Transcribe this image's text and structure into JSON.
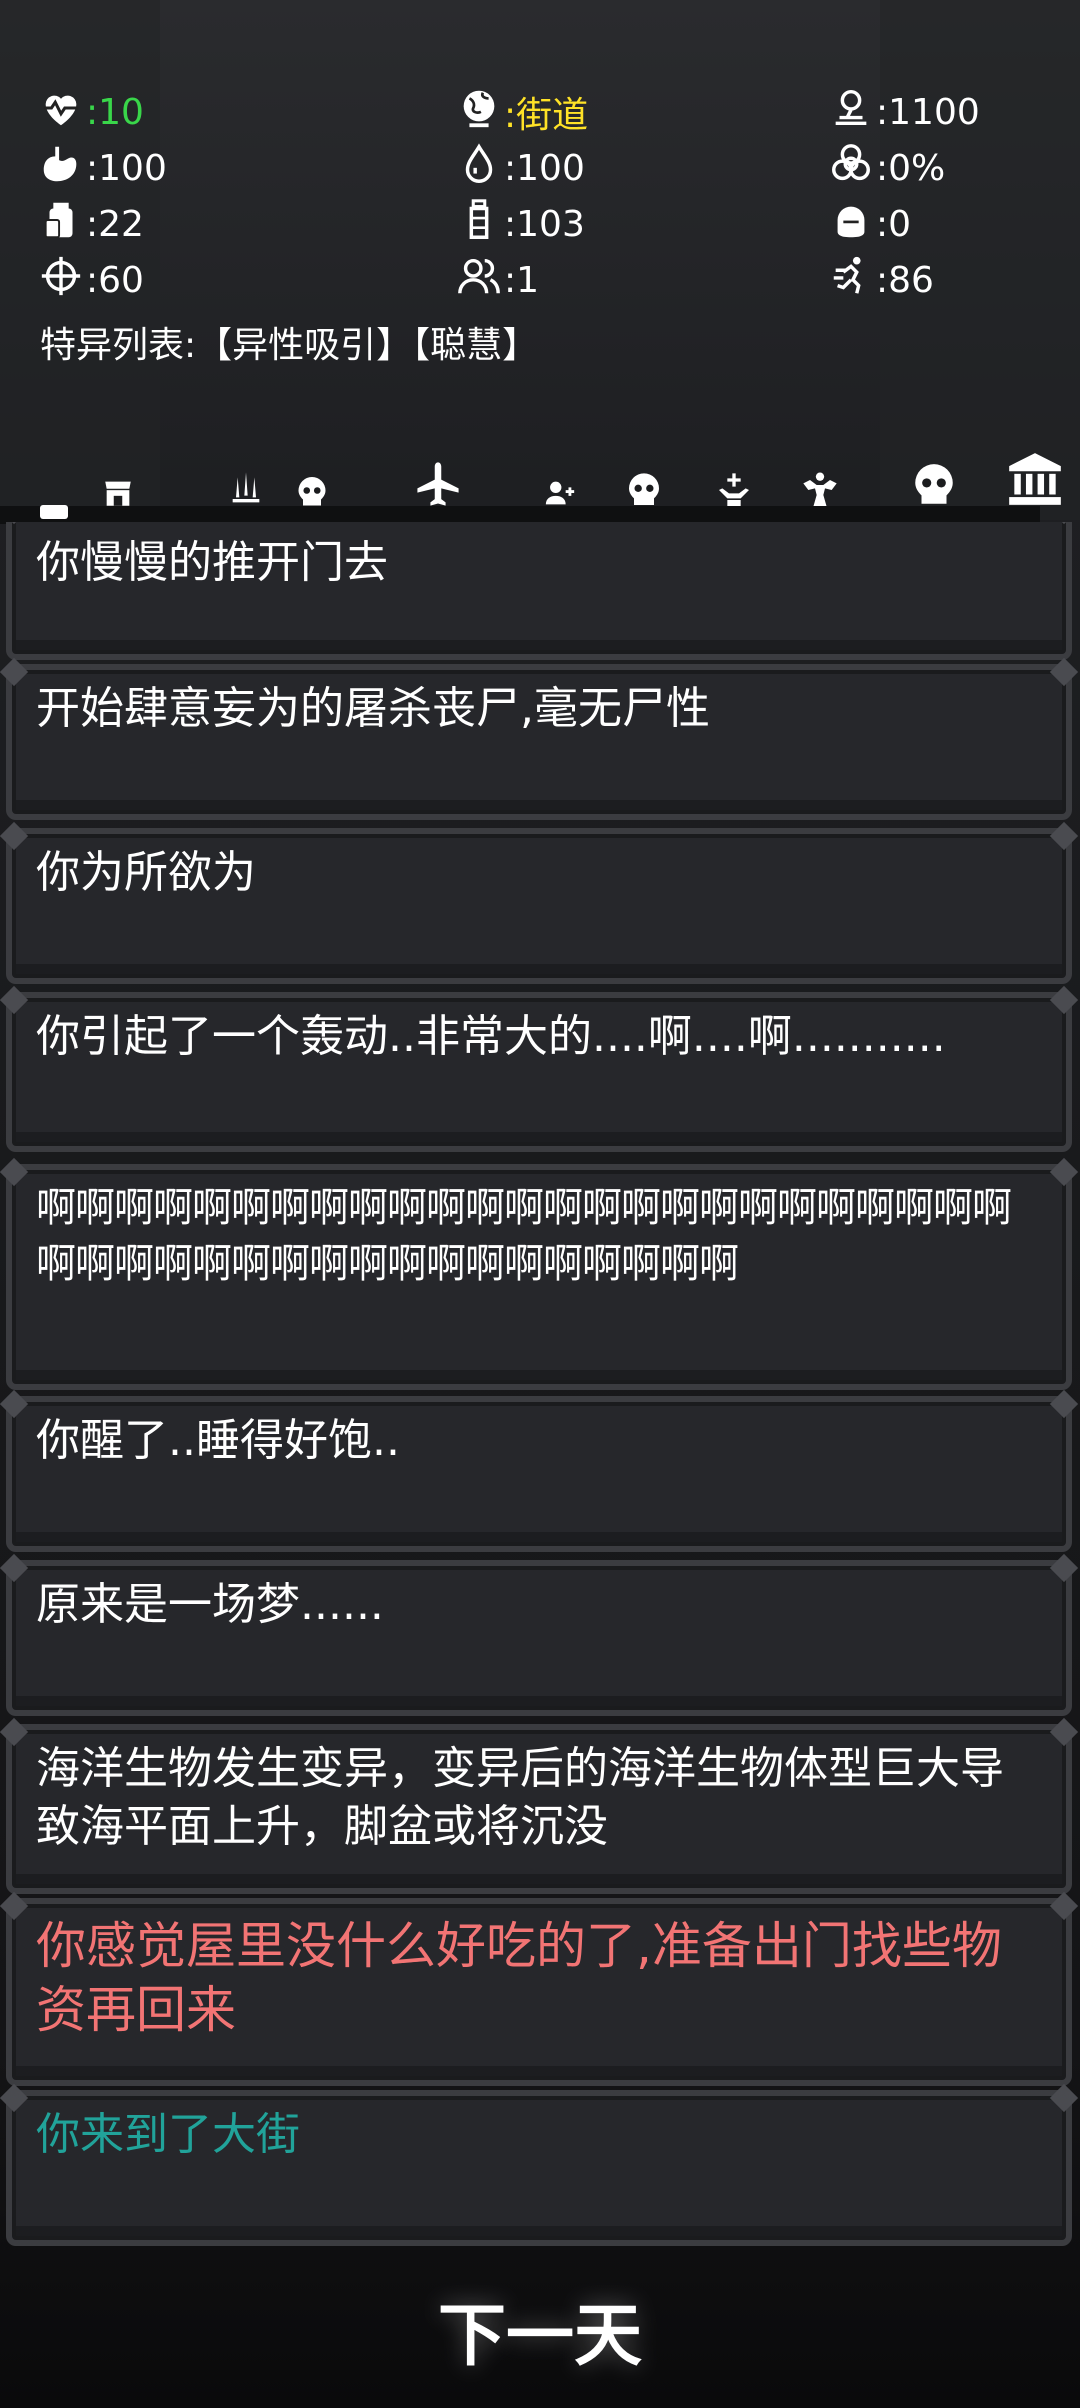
{
  "stats": {
    "health": {
      "value": ":10",
      "color": "#39d64a",
      "icon": "heart-pulse-icon"
    },
    "location": {
      "value": ":街道",
      "color": "#ffe227",
      "icon": "globe-icon"
    },
    "distance": {
      "value": ":1100",
      "color": "#ffffff",
      "icon": "map-pin-icon"
    },
    "hunger": {
      "value": ":100",
      "color": "#ffffff",
      "icon": "stomach-icon"
    },
    "thirst": {
      "value": ":100",
      "color": "#ffffff",
      "icon": "water-drop-icon"
    },
    "infection": {
      "value": ":0%",
      "color": "#ffffff",
      "icon": "biohazard-icon"
    },
    "food": {
      "value": ":22",
      "color": "#ffffff",
      "icon": "food-can-icon"
    },
    "water": {
      "value": ":103",
      "color": "#ffffff",
      "icon": "water-bottle-icon"
    },
    "armor": {
      "value": ":0",
      "color": "#ffffff",
      "icon": "helmet-icon"
    },
    "ammo": {
      "value": ":60",
      "color": "#ffffff",
      "icon": "crosshair-icon"
    },
    "survivors": {
      "value": ":1",
      "color": "#ffffff",
      "icon": "people-icon"
    },
    "agility": {
      "value": ":86",
      "color": "#ffffff",
      "icon": "running-icon"
    }
  },
  "traits": "特异列表:【异性吸引】【聪慧】",
  "menu_icons": [
    "shop-icon",
    "weapons-icon",
    "skull-icon",
    "airplane-icon",
    "add-person-icon",
    "skull-icon",
    "hand-cross-icon",
    "strength-icon",
    "skull-icon",
    "bank-icon"
  ],
  "log": [
    {
      "text": "你慢慢的推开门去",
      "color": "#ffffff"
    },
    {
      "text": "开始肆意妄为的屠杀丧尸,毫无尸性",
      "color": "#ffffff"
    },
    {
      "text": "你为所欲为",
      "color": "#ffffff"
    },
    {
      "text": "你引起了一个轰动..非常大的....啊....啊...........",
      "color": "#ffffff"
    },
    {
      "text": "啊啊啊啊啊啊啊啊啊啊啊啊啊啊啊啊啊啊啊啊啊啊啊啊啊啊啊啊啊啊啊啊啊啊啊啊啊啊啊啊啊啊啊",
      "color": "#ffffff"
    },
    {
      "text": "你醒了..睡得好饱..",
      "color": "#ffffff"
    },
    {
      "text": "原来是一场梦......",
      "color": "#ffffff"
    },
    {
      "text": "海洋生物发生变异，变异后的海洋生物体型巨大导致海平面上升，脚盆或将沉没",
      "color": "#ffffff"
    },
    {
      "text": "你感觉屋里没什么好吃的了,准备出门找些物资再回来",
      "color": "#f27474"
    },
    {
      "text": "你来到了大街",
      "color": "#21a39a"
    }
  ],
  "next_day_label": "下一天"
}
